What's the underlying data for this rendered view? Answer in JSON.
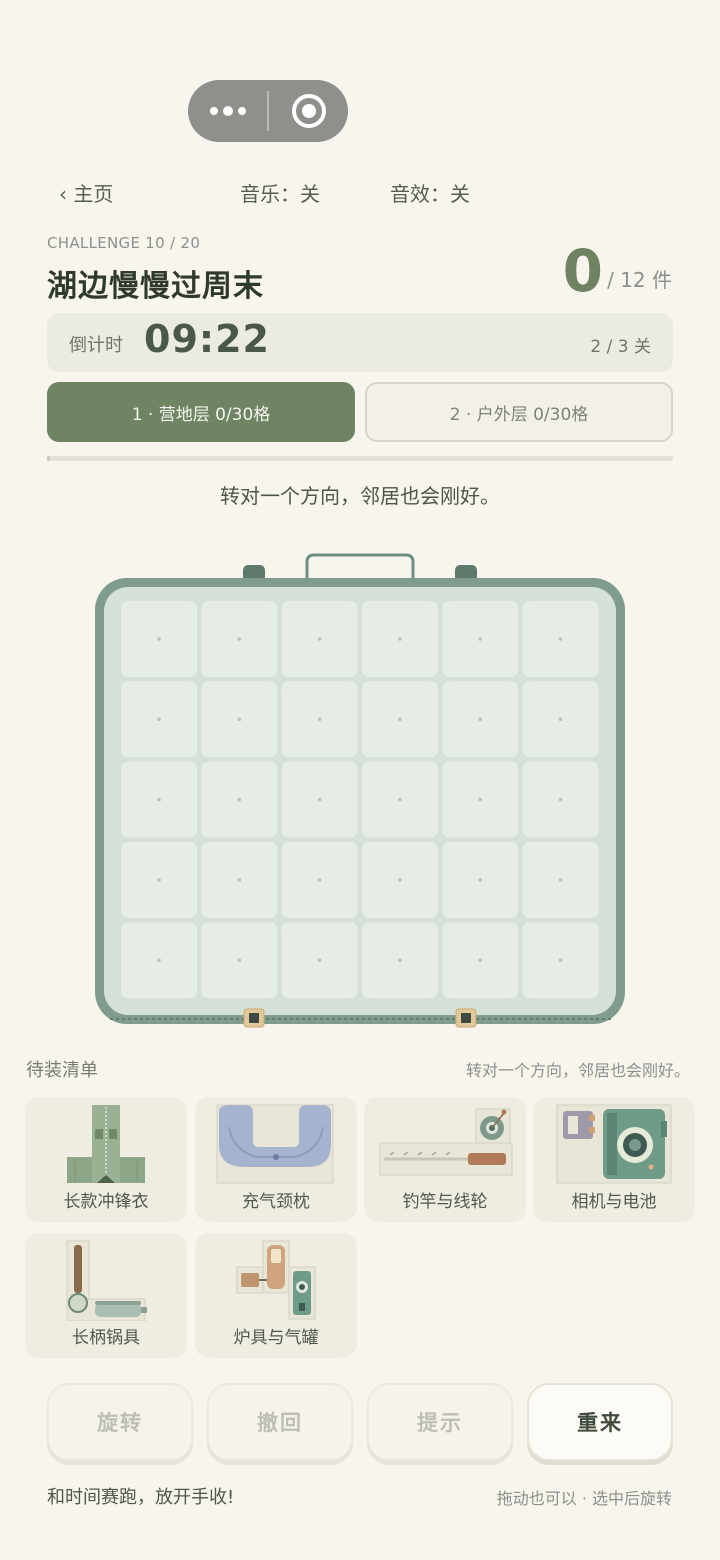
{
  "header": {
    "back_label": "‹ 主页",
    "music_label": "音乐：关",
    "sfx_label": "音效：关"
  },
  "challenge": {
    "label": "CHALLENGE 10 / 20",
    "title": "湖边慢慢过周末",
    "score": "0",
    "score_total": "/ 12 件"
  },
  "timer": {
    "label": "倒计时",
    "value": "09:22",
    "stage": "2 / 3 关"
  },
  "tabs": [
    {
      "label": "1 · 营地层 0/30格",
      "active": true
    },
    {
      "label": "2 · 户外层 0/30格",
      "active": false
    }
  ],
  "progress": 0,
  "hint": "转对一个方向，邻居也会刚好。",
  "board": {
    "rows": 5,
    "cols": 6
  },
  "inventory": {
    "title": "待装清单",
    "hint": "转对一个方向，邻居也会刚好。",
    "items": [
      {
        "label": "长款冲锋衣",
        "icon": "jacket-icon"
      },
      {
        "label": "充气颈枕",
        "icon": "neck-pillow-icon"
      },
      {
        "label": "钓竿与线轮",
        "icon": "fishing-rod-icon"
      },
      {
        "label": "相机与电池",
        "icon": "camera-icon"
      },
      {
        "label": "长柄锅具",
        "icon": "pan-icon"
      },
      {
        "label": "炉具与气罐",
        "icon": "stove-icon"
      }
    ]
  },
  "actions": {
    "rotate": "旋转",
    "undo": "撤回",
    "hint": "提示",
    "restart": "重来"
  },
  "footer": {
    "left": "和时间赛跑，放开手收!",
    "right": "拖动也可以 · 选中后旋转"
  },
  "colors": {
    "accent": "#6e8462",
    "board_frame": "#7f9c8d",
    "cell": "#e6ece6",
    "background": "#f8f5ee"
  }
}
